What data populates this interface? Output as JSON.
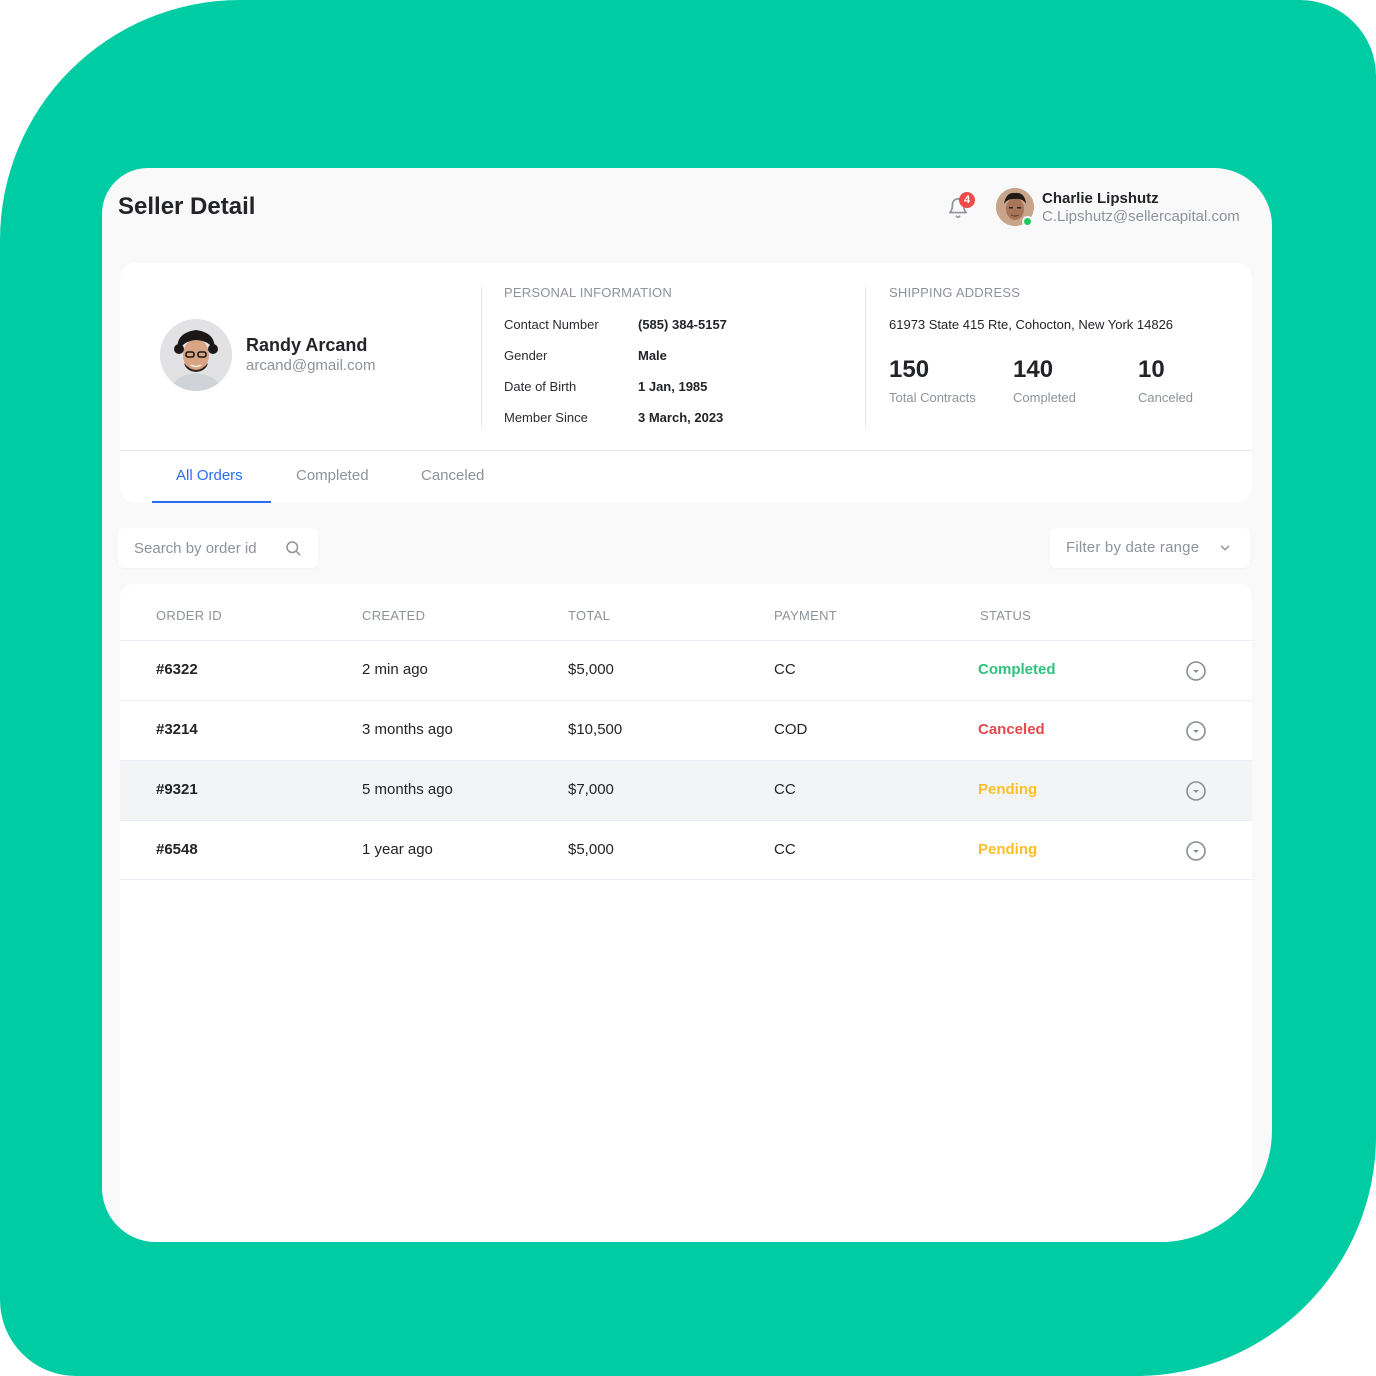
{
  "page": {
    "title": "Seller Detail"
  },
  "header": {
    "notification_count": "4",
    "user": {
      "name": "Charlie Lipshutz",
      "email": "C.Lipshutz@sellercapital.com",
      "status": "online"
    }
  },
  "seller": {
    "name": "Randy Arcand",
    "email": "arcand@gmail.com"
  },
  "personal_info": {
    "title": "PERSONAL INFORMATION",
    "rows": [
      {
        "label": "Contact Number",
        "value": "(585) 384-5157"
      },
      {
        "label": "Gender",
        "value": "Male"
      },
      {
        "label": "Date of Birth",
        "value": "1 Jan, 1985"
      },
      {
        "label": "Member Since",
        "value": "3 March, 2023"
      }
    ]
  },
  "shipping": {
    "title": "SHIPPING ADDRESS",
    "address": "61973 State 415 Rte, Cohocton, New York 14826",
    "stats": [
      {
        "value": "150",
        "label": "Total Contracts"
      },
      {
        "value": "140",
        "label": "Completed"
      },
      {
        "value": "10",
        "label": "Canceled"
      }
    ]
  },
  "tabs": [
    {
      "label": "All Orders",
      "active": true
    },
    {
      "label": "Completed",
      "active": false
    },
    {
      "label": "Canceled",
      "active": false
    }
  ],
  "search": {
    "placeholder": "Search by order id",
    "value": ""
  },
  "filter": {
    "label": "Filter by date range"
  },
  "table": {
    "columns": [
      "ORDER ID",
      "CREATED",
      "TOTAL",
      "PAYMENT",
      "STATUS"
    ],
    "rows": [
      {
        "id": "#6322",
        "created": "2 min ago",
        "total": "$5,000",
        "payment": "CC",
        "status": "Completed",
        "highlighted": false
      },
      {
        "id": "#3214",
        "created": "3 months ago",
        "total": "$10,500",
        "payment": "COD",
        "status": "Canceled",
        "highlighted": false
      },
      {
        "id": "#9321",
        "created": "5 months ago",
        "total": "$7,000",
        "payment": "CC",
        "status": "Pending",
        "highlighted": true
      },
      {
        "id": "#6548",
        "created": "1 year ago",
        "total": "$5,000",
        "payment": "CC",
        "status": "Pending",
        "highlighted": false
      }
    ]
  },
  "colors": {
    "brand_background": "#00cca3",
    "accent": "#2b6ef0",
    "notification_badge": "#ef4b4b",
    "online": "#22c55e",
    "status": {
      "Completed": "#2ec27e",
      "Canceled": "#e5484d",
      "Pending": "#fbbf24"
    }
  }
}
